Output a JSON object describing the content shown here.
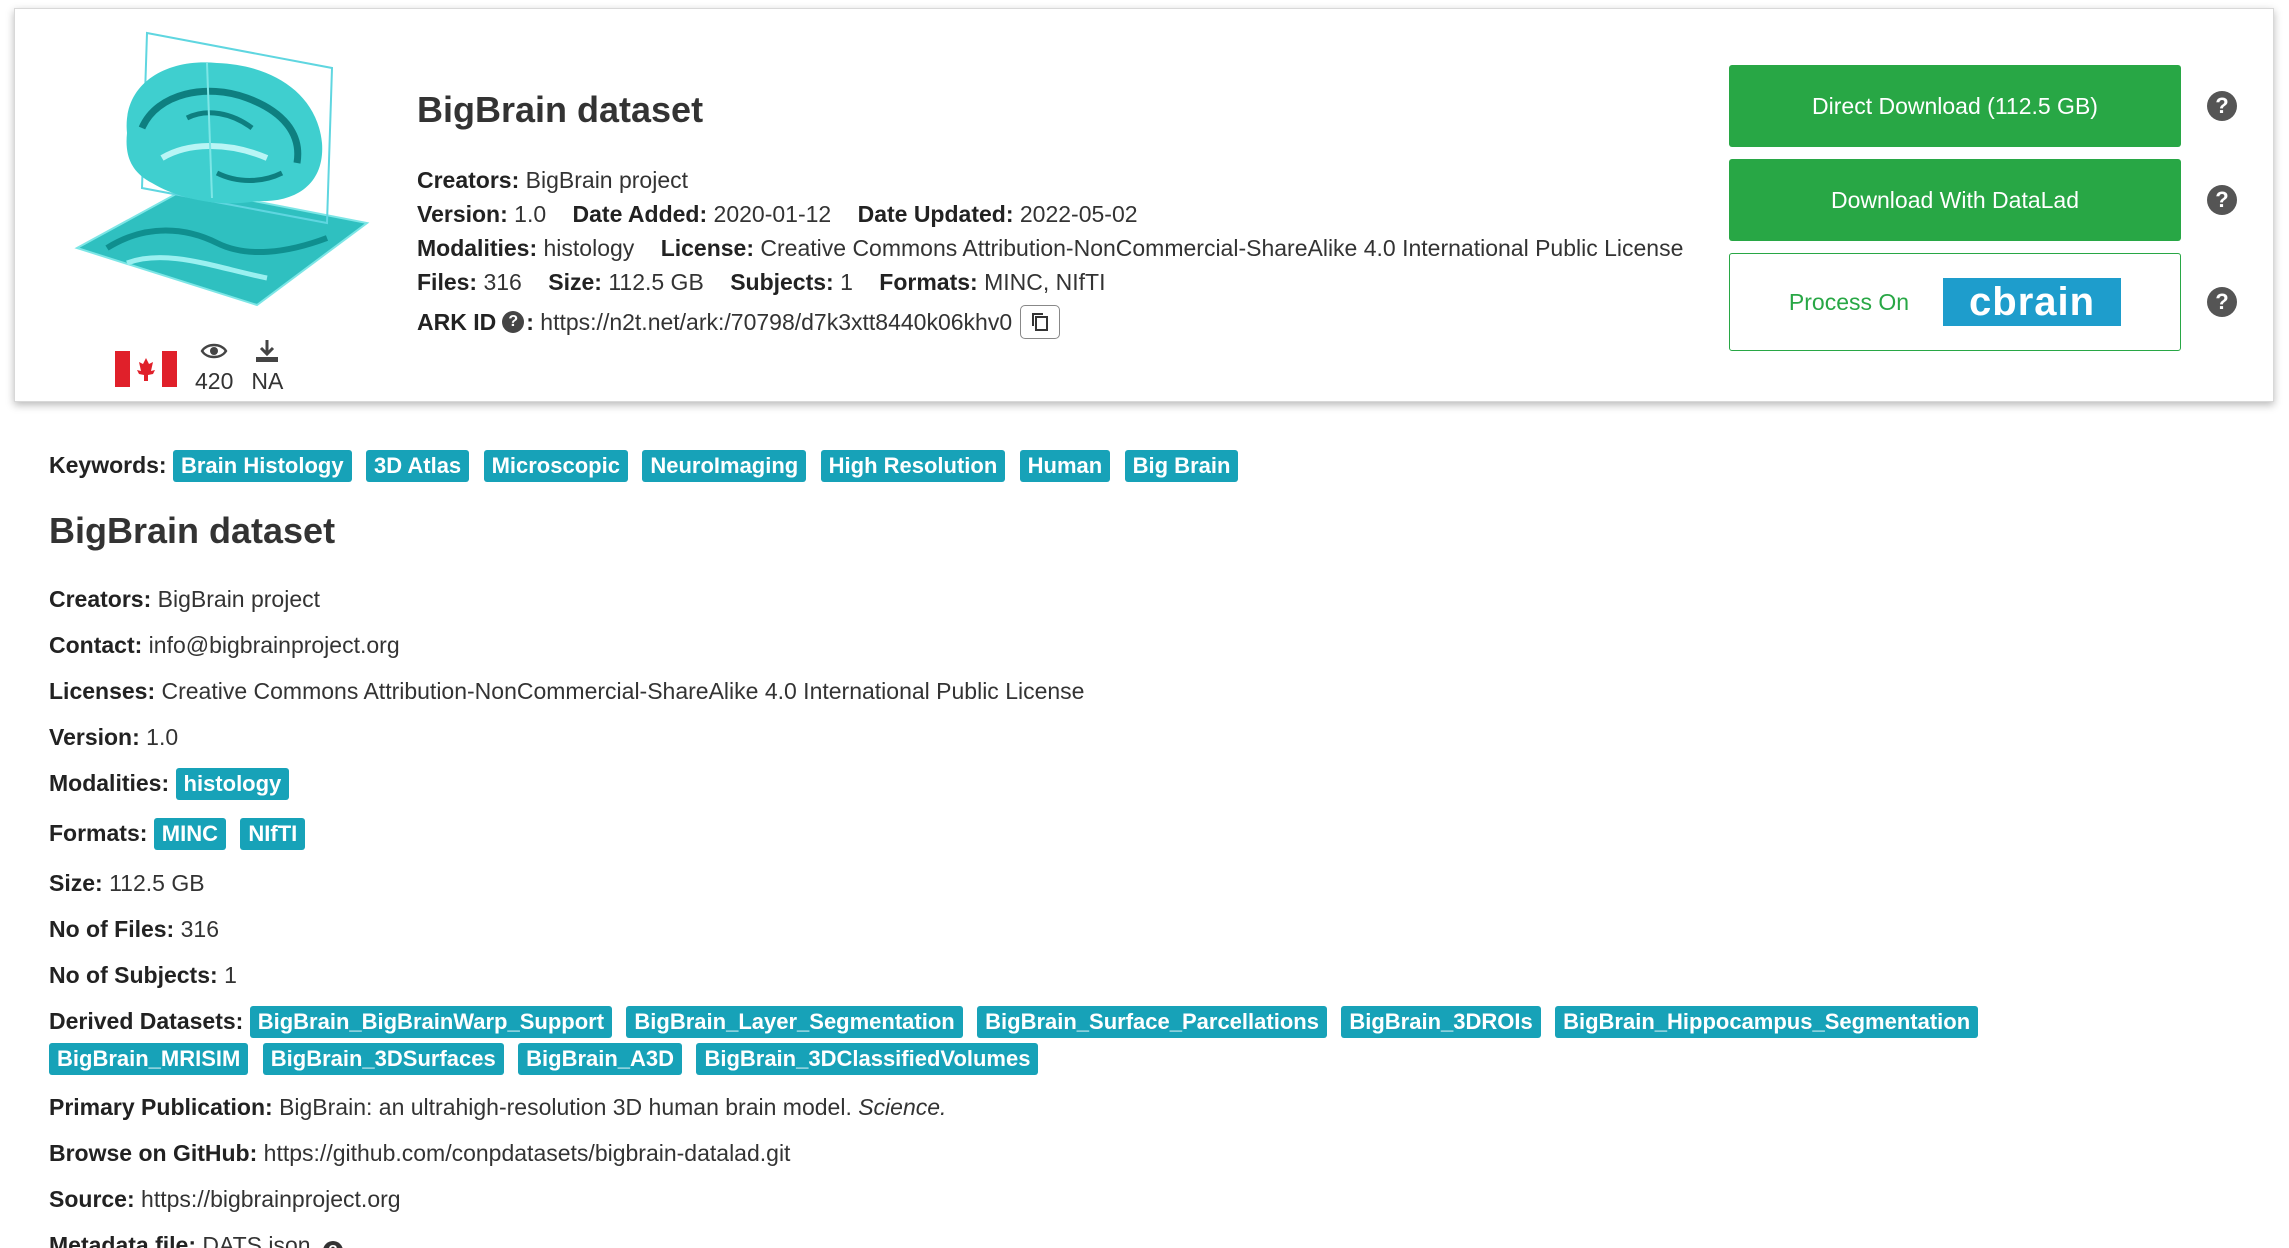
{
  "header": {
    "title": "BigBrain dataset",
    "creators_label": "Creators:",
    "creators": "BigBrain project",
    "version_label": "Version:",
    "version": "1.0",
    "date_added_label": "Date Added:",
    "date_added": "2020-01-12",
    "date_updated_label": "Date Updated:",
    "date_updated": "2022-05-02",
    "modalities_label": "Modalities:",
    "modalities": "histology",
    "license_label": "License:",
    "license": "Creative Commons Attribution-NonCommercial-ShareAlike 4.0 International Public License",
    "files_label": "Files:",
    "files": "316",
    "size_label": "Size:",
    "size": "112.5 GB",
    "subjects_label": "Subjects:",
    "subjects": "1",
    "formats_label": "Formats:",
    "formats": "MINC, NIfTI",
    "ark_label": "ARK ID",
    "ark_help": "?",
    "ark_colon": ":",
    "ark_url": "https://n2t.net/ark:/70798/d7k3xtt8440k06khv0",
    "views": "420",
    "downloads": "NA",
    "icons": {
      "flag": "canada-flag-icon",
      "views": "eye-icon",
      "downloads": "download-icon",
      "copy": "copy-icon"
    }
  },
  "actions": {
    "direct_download": "Direct Download (112.5 GB)",
    "datalad_download": "Download With DataLad",
    "process_on": "Process On",
    "cbrain_logo": "cbrain",
    "help": "?"
  },
  "colors": {
    "green": "#28a745",
    "tag": "#17a2b8",
    "cbrain": "#1e9dcc",
    "brain": "#3fcfcf"
  },
  "keywords": {
    "label": "Keywords:",
    "items": [
      "Brain Histology",
      "3D Atlas",
      "Microscopic",
      "NeuroImaging",
      "High Resolution",
      "Human",
      "Big Brain"
    ]
  },
  "details": {
    "title": "BigBrain dataset",
    "creators_label": "Creators:",
    "creators": "BigBrain project",
    "contact_label": "Contact:",
    "contact": "info@bigbrainproject.org",
    "licenses_label": "Licenses:",
    "licenses": "Creative Commons Attribution-NonCommercial-ShareAlike 4.0 International Public License",
    "version_label": "Version:",
    "version": "1.0",
    "modalities_label": "Modalities:",
    "modalities": [
      "histology"
    ],
    "formats_label": "Formats:",
    "formats": [
      "MINC",
      "NIfTI"
    ],
    "size_label": "Size:",
    "size": "112.5 GB",
    "files_label": "No of Files:",
    "files": "316",
    "subjects_label": "No of Subjects:",
    "subjects": "1",
    "derived_label": "Derived Datasets:",
    "derived": [
      "BigBrain_BigBrainWarp_Support",
      "BigBrain_Layer_Segmentation",
      "BigBrain_Surface_Parcellations",
      "BigBrain_3DROIs",
      "BigBrain_Hippocampus_Segmentation",
      "BigBrain_MRISIM",
      "BigBrain_3DSurfaces",
      "BigBrain_A3D",
      "BigBrain_3DClassifiedVolumes"
    ],
    "publication_label": "Primary Publication:",
    "publication_title": "BigBrain: an ultrahigh-resolution 3D human brain model.",
    "publication_journal": "Science.",
    "github_label": "Browse on GitHub:",
    "github": "https://github.com/conpdatasets/bigbrain-datalad.git",
    "source_label": "Source:",
    "source": "https://bigbrainproject.org",
    "metadata_label": "Metadata file:",
    "metadata": "DATS.json",
    "metadata_help": "?"
  }
}
